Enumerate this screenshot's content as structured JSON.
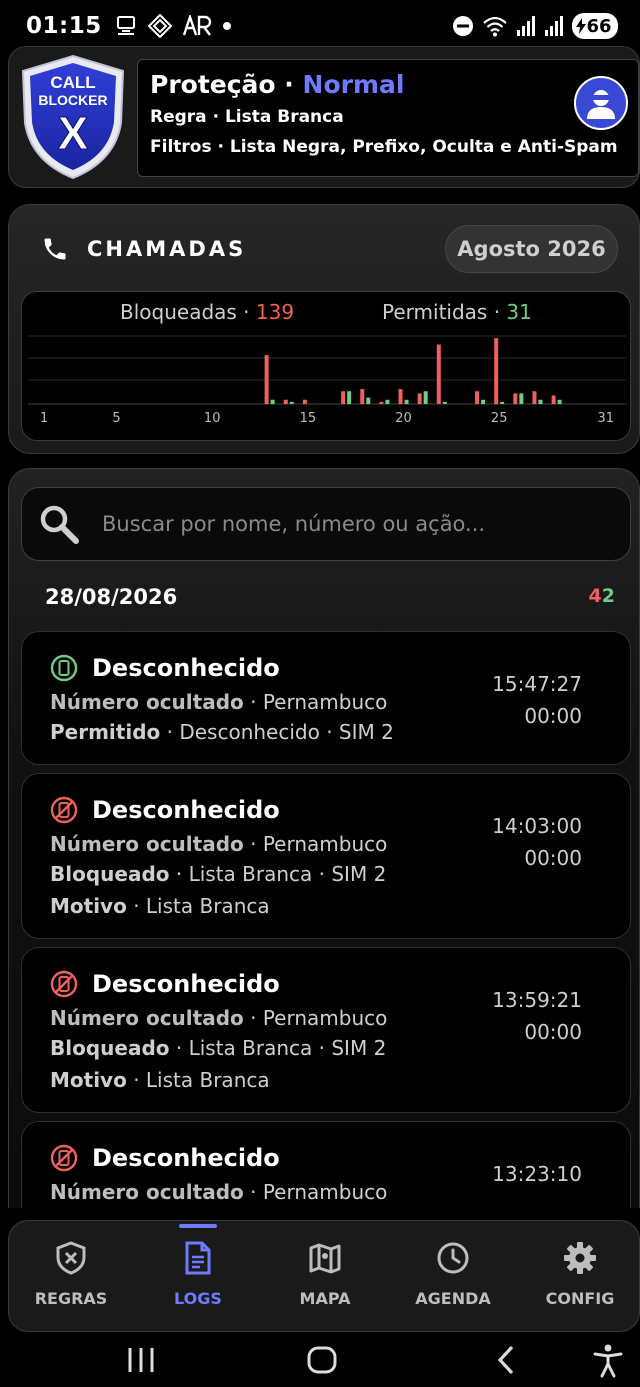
{
  "status_bar": {
    "time": "01:15",
    "battery": "66"
  },
  "header": {
    "logo_text_1": "CALL",
    "logo_text_2": "BLOCKER",
    "logo_text_3": "X",
    "title_prefix": "Proteção · ",
    "title_status": "Normal",
    "rule_line": "Regra · Lista Branca",
    "filters_line": "Filtros · Lista Negra, Prefixo, Oculta e Anti-Spam"
  },
  "calls": {
    "title": "CHAMADAS",
    "month": "Agosto 2026"
  },
  "chart_data": {
    "type": "bar",
    "legend": {
      "blocked_label": "Bloqueadas · ",
      "blocked_value": "139",
      "allowed_label": "Permitidas · ",
      "allowed_value": "31"
    },
    "x_ticks": [
      "1",
      "5",
      "10",
      "15",
      "20",
      "25",
      "31"
    ],
    "x_tick_values": [
      1,
      5,
      10,
      15,
      20,
      25,
      31
    ],
    "xlim": [
      1,
      31
    ],
    "ylim": [
      0,
      32
    ],
    "grid": true,
    "colors": {
      "blocked": "#f0605d",
      "allowed": "#6fce84"
    },
    "series": [
      {
        "name": "Bloqueadas",
        "x": [
          13,
          14,
          15,
          17,
          18,
          19,
          20,
          21,
          22,
          24,
          25,
          26,
          27,
          28
        ],
        "values": [
          23,
          2,
          2,
          6,
          7,
          1,
          7,
          5,
          28,
          6,
          31,
          5,
          6,
          4
        ]
      },
      {
        "name": "Permitidas",
        "x": [
          13,
          14,
          17,
          18,
          19,
          20,
          21,
          22,
          24,
          25,
          26,
          27,
          28
        ],
        "values": [
          2,
          1,
          6,
          3,
          2,
          2,
          6,
          1,
          2,
          1,
          5,
          2,
          2
        ]
      }
    ]
  },
  "search": {
    "placeholder": "Buscar por nome, número ou ação..."
  },
  "log_group": {
    "date": "28/08/2026",
    "count_blocked": "4",
    "count_allowed": "2"
  },
  "logs": [
    {
      "name": "Desconhecido",
      "number": "Número ocultado",
      "location": " · Pernambuco",
      "action": "Permitido",
      "action_detail": " · Desconhecido · SIM 2",
      "time": "15:47:27",
      "duration": "00:00",
      "status": "allowed"
    },
    {
      "name": "Desconhecido",
      "number": "Número ocultado",
      "location": " · Pernambuco",
      "action": "Bloqueado",
      "action_detail": " · Lista Branca · SIM 2",
      "reason_label": "Motivo",
      "reason": " · Lista Branca",
      "time": "14:03:00",
      "duration": "00:00",
      "status": "blocked"
    },
    {
      "name": "Desconhecido",
      "number": "Número ocultado",
      "location": " · Pernambuco",
      "action": "Bloqueado",
      "action_detail": " · Lista Branca · SIM 2",
      "reason_label": "Motivo",
      "reason": " · Lista Branca",
      "time": "13:59:21",
      "duration": "00:00",
      "status": "blocked"
    },
    {
      "name": "Desconhecido",
      "number": "Número ocultado",
      "location": " · Pernambuco",
      "time": "13:23:10",
      "status": "blocked"
    }
  ],
  "nav": {
    "items": [
      {
        "label": "REGRAS",
        "icon": "shield-x-icon"
      },
      {
        "label": "LOGS",
        "icon": "document-icon",
        "active": true
      },
      {
        "label": "MAPA",
        "icon": "map-icon"
      },
      {
        "label": "AGENDA",
        "icon": "clock-icon"
      },
      {
        "label": "CONFIG",
        "icon": "gear-icon"
      }
    ]
  }
}
